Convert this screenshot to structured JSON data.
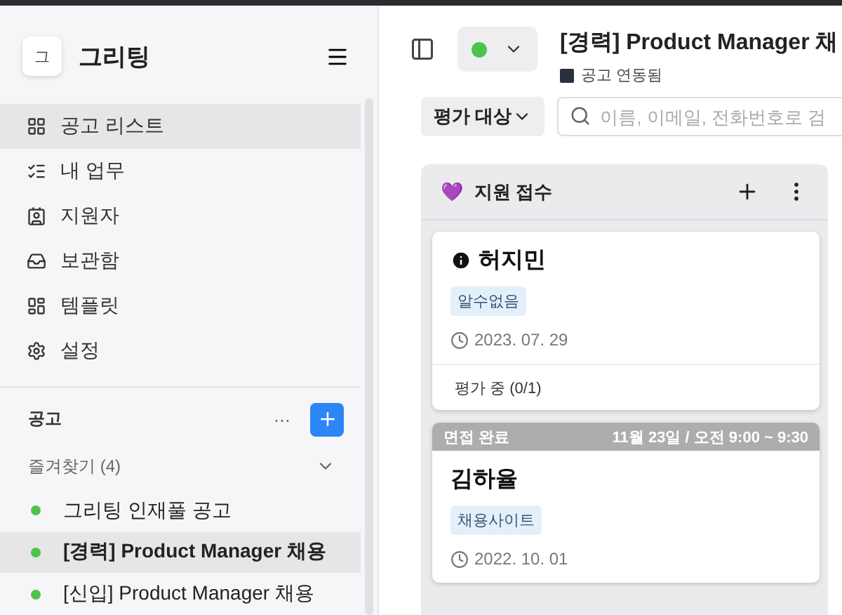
{
  "app": {
    "logo_letter": "그",
    "name": "그리팅"
  },
  "nav": [
    {
      "label": "공고 리스트",
      "selected": true
    },
    {
      "label": "내 업무",
      "selected": false
    },
    {
      "label": "지원자",
      "selected": false
    },
    {
      "label": "보관함",
      "selected": false
    },
    {
      "label": "템플릿",
      "selected": false
    },
    {
      "label": "설정",
      "selected": false
    }
  ],
  "jobs_section": {
    "title": "공고",
    "more": "···",
    "favorites_label": "즐겨찾기 (4)",
    "expanded": true,
    "items": [
      {
        "label": "그리팅 인재풀 공고",
        "color": "#4cc44c",
        "selected": false
      },
      {
        "label": "[경력] Product Manager 채용",
        "color": "#4cc44c",
        "selected": true
      },
      {
        "label": "[신입] Product Manager 채용",
        "color": "#4cc44c",
        "selected": false
      }
    ]
  },
  "header": {
    "status_active": true,
    "title": "[경력] Product Manager 채",
    "linked_label": "공고 연동됨"
  },
  "filter": {
    "value": "평가 대상",
    "search_placeholder": "이름, 이메일, 전화번호로 검"
  },
  "column": {
    "emoji": "💜",
    "title": "지원 접수",
    "cards": [
      {
        "info": true,
        "name": "허지민",
        "tag": "알수없음",
        "date": "2023. 07. 29",
        "footer": "평가 중 (0/1)"
      },
      {
        "banner": {
          "status": "면접 완료",
          "schedule": "11월 23일 / 오전 9:00 ~ 9:30"
        },
        "info": false,
        "name": "김하율",
        "tag": "채용사이트",
        "date": "2022. 10. 01"
      }
    ]
  }
}
